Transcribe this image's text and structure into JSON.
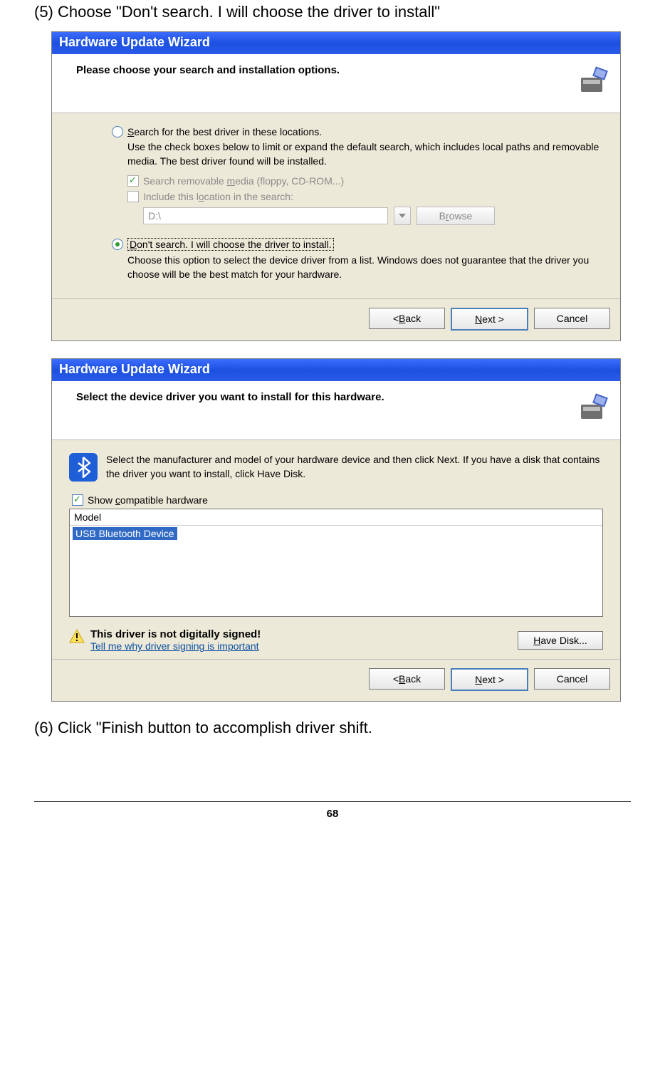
{
  "instructions": {
    "step5": "(5) Choose \"Don't search. I will choose the driver to install\"",
    "step6": "(6) Click \"Finish button to accomplish driver shift."
  },
  "wizard1": {
    "title": "Hardware Update Wizard",
    "heading": "Please choose your search and installation options.",
    "radio_search_label": "Search for the best driver in these locations.",
    "radio_search_desc": "Use the check boxes below to limit or expand the default search, which includes local paths and removable media. The best driver found will be installed.",
    "check_removable": "Search removable media (floppy, CD-ROM...)",
    "check_include": "Include this location in the search:",
    "path_value": "D:\\",
    "browse_label": "Browse",
    "radio_dont_label": "Don't search. I will choose the driver to install.",
    "radio_dont_desc": "Choose this option to select the device driver from a list.  Windows does not guarantee that the driver you choose will be the best match for your hardware.",
    "back_label": "< Back",
    "next_label": "Next >",
    "cancel_label": "Cancel"
  },
  "wizard2": {
    "title": "Hardware Update Wizard",
    "heading": "Select the device driver you want to install for this hardware.",
    "select_text": "Select the manufacturer and model of your hardware device and then click Next. If you have a disk that contains the driver you want to install, click Have Disk.",
    "compat_label": "Show compatible hardware",
    "model_header": "Model",
    "model_item": "USB Bluetooth Device",
    "sign_title": "This driver is not digitally signed!",
    "sign_link": "Tell me why driver signing is important",
    "have_disk_label": "Have Disk...",
    "back_label": "< Back",
    "next_label": "Next >",
    "cancel_label": "Cancel"
  },
  "page_number": "68"
}
